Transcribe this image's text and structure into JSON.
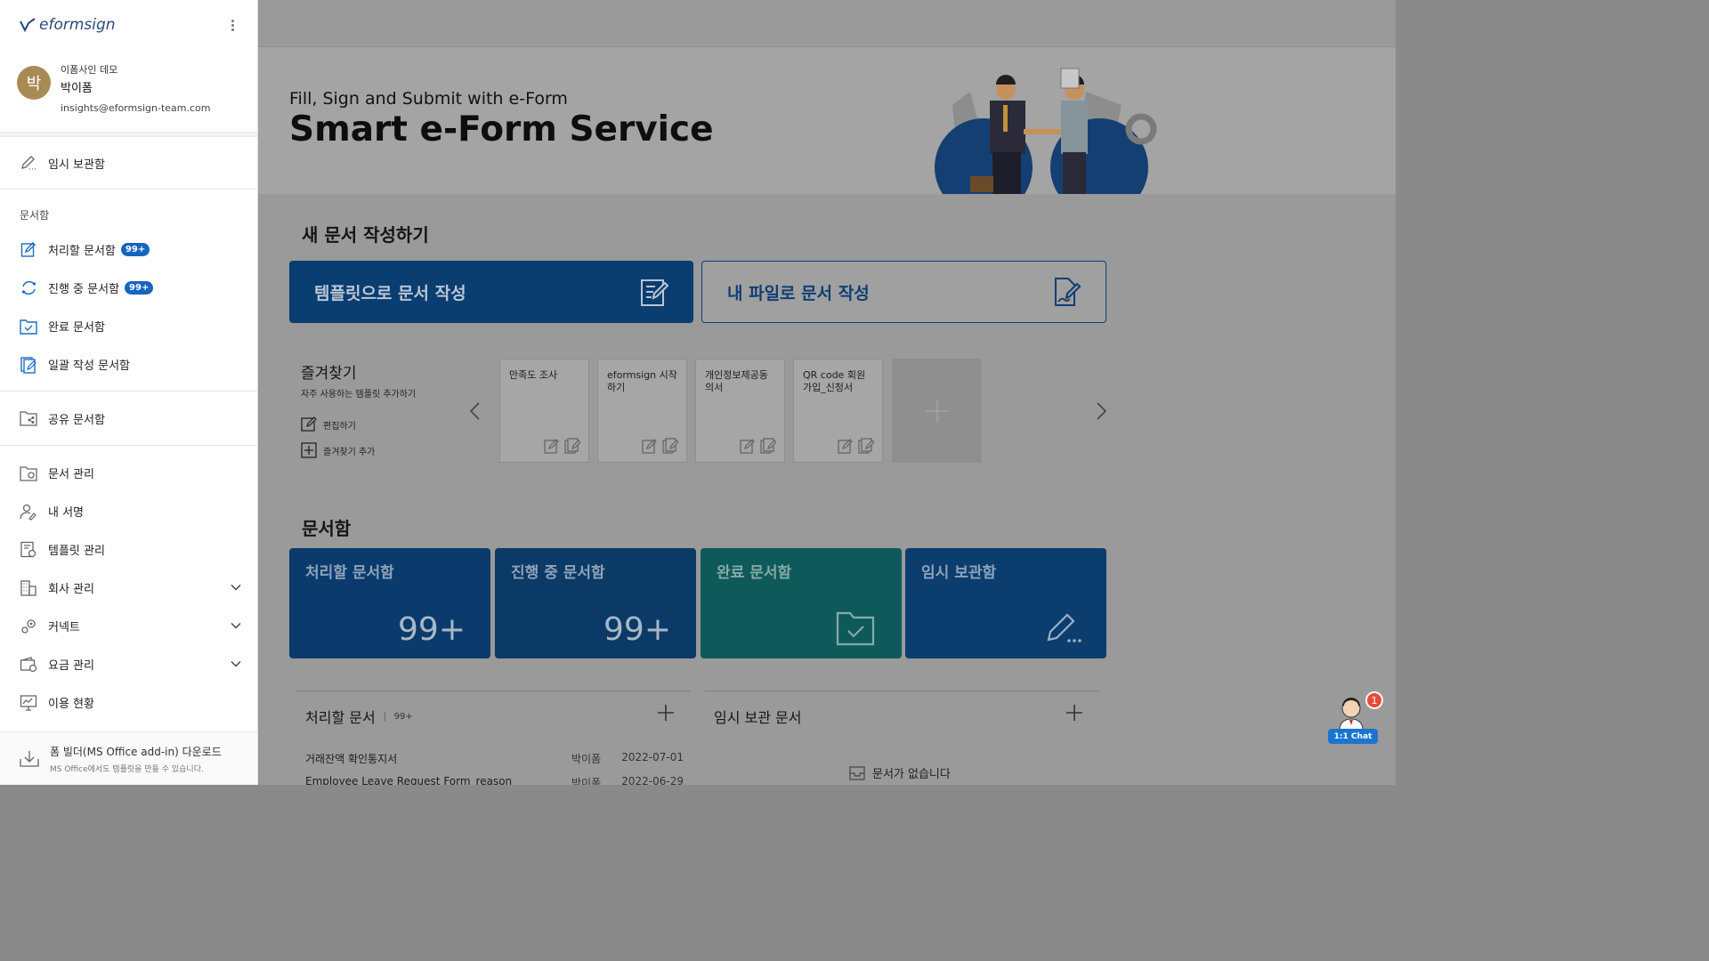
{
  "brand": {
    "logo_text": "eformsign"
  },
  "profile": {
    "avatar_char": "박",
    "company": "이폼사인 데모",
    "name": "박이폼",
    "email": "insights@eformsign-team.com"
  },
  "sidebar": {
    "drafts": "임시 보관함",
    "docs_section": "문서함",
    "docs": [
      {
        "label": "처리할 문서함",
        "badge": "99+"
      },
      {
        "label": "진행 중 문서함",
        "badge": "99+"
      },
      {
        "label": "완료 문서함"
      },
      {
        "label": "일괄 작성 문서함"
      }
    ],
    "shared": "공유 문서함",
    "manage": [
      {
        "label": "문서 관리"
      },
      {
        "label": "내 서명"
      },
      {
        "label": "템플릿 관리"
      },
      {
        "label": "회사 관리",
        "expandable": true
      },
      {
        "label": "커넥트",
        "expandable": true
      },
      {
        "label": "요금 관리",
        "expandable": true
      },
      {
        "label": "이용 현황"
      }
    ],
    "download": {
      "title": "폼 빌더(MS Office add-in) 다운로드",
      "subtitle": "MS Office에서도 템플릿을 만들 수 있습니다."
    }
  },
  "hero": {
    "subtitle": "Fill, Sign and Submit with e-Form",
    "title": "Smart e-Form Service"
  },
  "new_doc": {
    "heading": "새 문서 작성하기",
    "from_template": "템플릿으로 문서 작성",
    "from_file": "내 파일로 문서 작성"
  },
  "favorites": {
    "title": "즐겨찾기",
    "subtitle": "자주 사용하는 템플릿 추가하기",
    "edit": "편집하기",
    "add": "즐겨찾기 추가",
    "cards": [
      {
        "title": "만족도 조사"
      },
      {
        "title": "eformsign 시작하기"
      },
      {
        "title": "개인정보제공동의서"
      },
      {
        "title": "QR code 회원가입_신청서"
      }
    ]
  },
  "boxes": {
    "heading": "문서함",
    "items": [
      {
        "title": "처리할 문서함",
        "count": "99+"
      },
      {
        "title": "진행 중 문서함",
        "count": "99+"
      },
      {
        "title": "완료 문서함"
      },
      {
        "title": "임시 보관함"
      }
    ]
  },
  "todo_panel": {
    "title": "처리할 문서",
    "count": "99+",
    "rows": [
      {
        "name": "거래잔액 확인통지서",
        "user": "박이폼",
        "date": "2022-07-01"
      },
      {
        "name": "Employee Leave Request Form_reason",
        "user": "박이폼",
        "date": "2022-06-29"
      }
    ]
  },
  "drafts_panel": {
    "title": "임시 보관 문서",
    "empty": "문서가 없습니다"
  },
  "chat": {
    "label": "1:1 Chat",
    "badge": "1"
  },
  "colors": {
    "primary": "#0a3d70",
    "teal": "#0e5a5a",
    "badge": "#1565c0",
    "chat": "#1a75d1"
  }
}
